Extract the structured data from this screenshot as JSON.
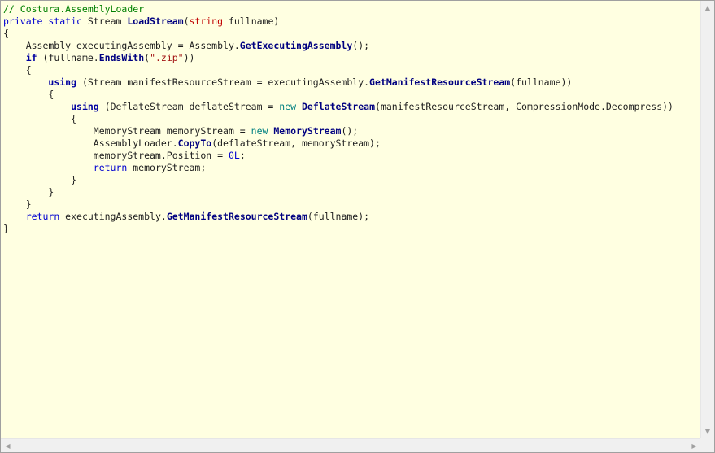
{
  "viewer": {
    "colors": {
      "background": "#ffffe1",
      "comment": "#008000",
      "keyword": "#0000d0",
      "control_keyword": "#0000a0",
      "new_keyword": "#008080",
      "method": "#000080",
      "string": "#a31515",
      "builtin_type": "#c00000",
      "text": "#1e1e1e"
    },
    "code_lines": [
      [
        {
          "t": "comment",
          "v": "// Costura.AssemblyLoader"
        }
      ],
      [
        {
          "t": "keyword",
          "v": "private"
        },
        {
          "t": "ident",
          "v": " "
        },
        {
          "t": "keyword",
          "v": "static"
        },
        {
          "t": "ident",
          "v": " Stream "
        },
        {
          "t": "method",
          "v": "LoadStream"
        },
        {
          "t": "punct",
          "v": "("
        },
        {
          "t": "kwtype",
          "v": "string"
        },
        {
          "t": "ident",
          "v": " fullname)"
        }
      ],
      [
        {
          "t": "punct",
          "v": "{"
        }
      ],
      [
        {
          "t": "ident",
          "v": "    Assembly executingAssembly = Assembly."
        },
        {
          "t": "method",
          "v": "GetExecutingAssembly"
        },
        {
          "t": "punct",
          "v": "();"
        }
      ],
      [
        {
          "t": "ident",
          "v": "    "
        },
        {
          "t": "ctl",
          "v": "if"
        },
        {
          "t": "ident",
          "v": " (fullname."
        },
        {
          "t": "method",
          "v": "EndsWith"
        },
        {
          "t": "punct",
          "v": "("
        },
        {
          "t": "string",
          "v": "\".zip\""
        },
        {
          "t": "punct",
          "v": "))"
        }
      ],
      [
        {
          "t": "ident",
          "v": "    {"
        }
      ],
      [
        {
          "t": "ident",
          "v": "        "
        },
        {
          "t": "ctl",
          "v": "using"
        },
        {
          "t": "ident",
          "v": " (Stream manifestResourceStream = executingAssembly."
        },
        {
          "t": "method",
          "v": "GetManifestResourceStream"
        },
        {
          "t": "punct",
          "v": "(fullname))"
        }
      ],
      [
        {
          "t": "ident",
          "v": "        {"
        }
      ],
      [
        {
          "t": "ident",
          "v": "            "
        },
        {
          "t": "ctl",
          "v": "using"
        },
        {
          "t": "ident",
          "v": " (DeflateStream deflateStream = "
        },
        {
          "t": "new",
          "v": "new"
        },
        {
          "t": "ident",
          "v": " "
        },
        {
          "t": "method",
          "v": "DeflateStream"
        },
        {
          "t": "punct",
          "v": "(manifestResourceStream, CompressionMode.Decompress))"
        }
      ],
      [
        {
          "t": "ident",
          "v": "            {"
        }
      ],
      [
        {
          "t": "ident",
          "v": "                MemoryStream memoryStream = "
        },
        {
          "t": "new",
          "v": "new"
        },
        {
          "t": "ident",
          "v": " "
        },
        {
          "t": "method",
          "v": "MemoryStream"
        },
        {
          "t": "punct",
          "v": "();"
        }
      ],
      [
        {
          "t": "ident",
          "v": "                AssemblyLoader."
        },
        {
          "t": "method",
          "v": "CopyTo"
        },
        {
          "t": "punct",
          "v": "(deflateStream, memoryStream);"
        }
      ],
      [
        {
          "t": "ident",
          "v": "                memoryStream.Position = "
        },
        {
          "t": "num",
          "v": "0L"
        },
        {
          "t": "punct",
          "v": ";"
        }
      ],
      [
        {
          "t": "ident",
          "v": "                "
        },
        {
          "t": "keyword",
          "v": "return"
        },
        {
          "t": "ident",
          "v": " memoryStream;"
        }
      ],
      [
        {
          "t": "ident",
          "v": "            }"
        }
      ],
      [
        {
          "t": "ident",
          "v": "        }"
        }
      ],
      [
        {
          "t": "ident",
          "v": "    }"
        }
      ],
      [
        {
          "t": "ident",
          "v": "    "
        },
        {
          "t": "keyword",
          "v": "return"
        },
        {
          "t": "ident",
          "v": " executingAssembly."
        },
        {
          "t": "method",
          "v": "GetManifestResourceStream"
        },
        {
          "t": "punct",
          "v": "(fullname);"
        }
      ],
      [
        {
          "t": "punct",
          "v": "}"
        }
      ]
    ]
  },
  "scrollbars": {
    "up_arrow_icon": "▲",
    "down_arrow_icon": "▼",
    "left_arrow_icon": "◀",
    "right_arrow_icon": "▶"
  }
}
